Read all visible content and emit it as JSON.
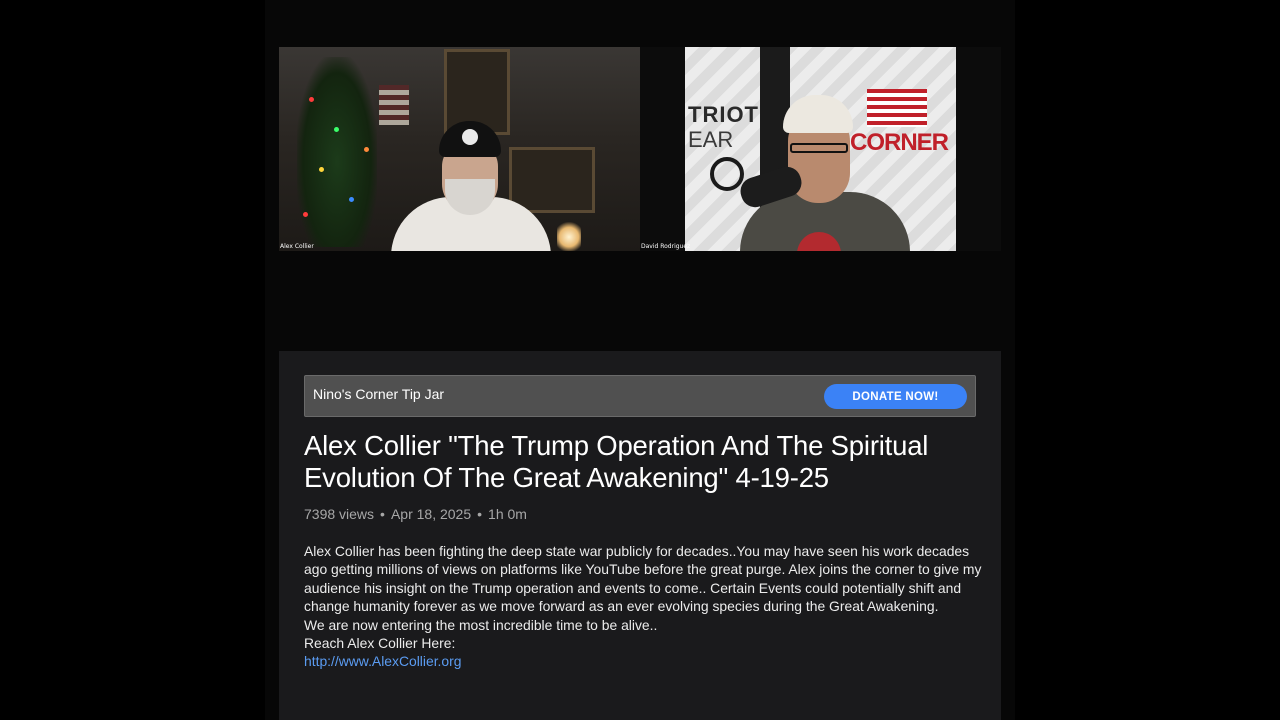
{
  "video": {
    "left_participant": "Alex Collier",
    "right_participant": "David Rodriguez",
    "backdrop_text_1": "TRIOT",
    "backdrop_text_2": "EAR",
    "backdrop_logo_text": "CORNER"
  },
  "tipjar": {
    "label": "Nino's Corner Tip Jar",
    "button_label": "DONATE NOW!",
    "button_color": "#3b82f6"
  },
  "video_info": {
    "title": "Alex Collier \"The Trump Operation And The Spiritual Evolution Of The Great Awakening\" 4-19-25",
    "views": "7398 views",
    "date": "Apr 18, 2025",
    "duration": "1h 0m",
    "separator": "•"
  },
  "description": {
    "paragraph": "Alex Collier has been fighting the deep state war publicly for decades..You may have seen his work decades ago getting millions of views on platforms like YouTube before the great purge. Alex joins the corner to give my audience his insight on the Trump operation and events to come.. Certain Events could potentially shift and change humanity forever as we move forward as an ever evolving species during the Great Awakening.",
    "line2": "We are now entering the most incredible time to be alive..",
    "line3": "Reach Alex Collier Here:",
    "link": "http://www.AlexCollier.org",
    "link_color": "#5b9cf2"
  }
}
